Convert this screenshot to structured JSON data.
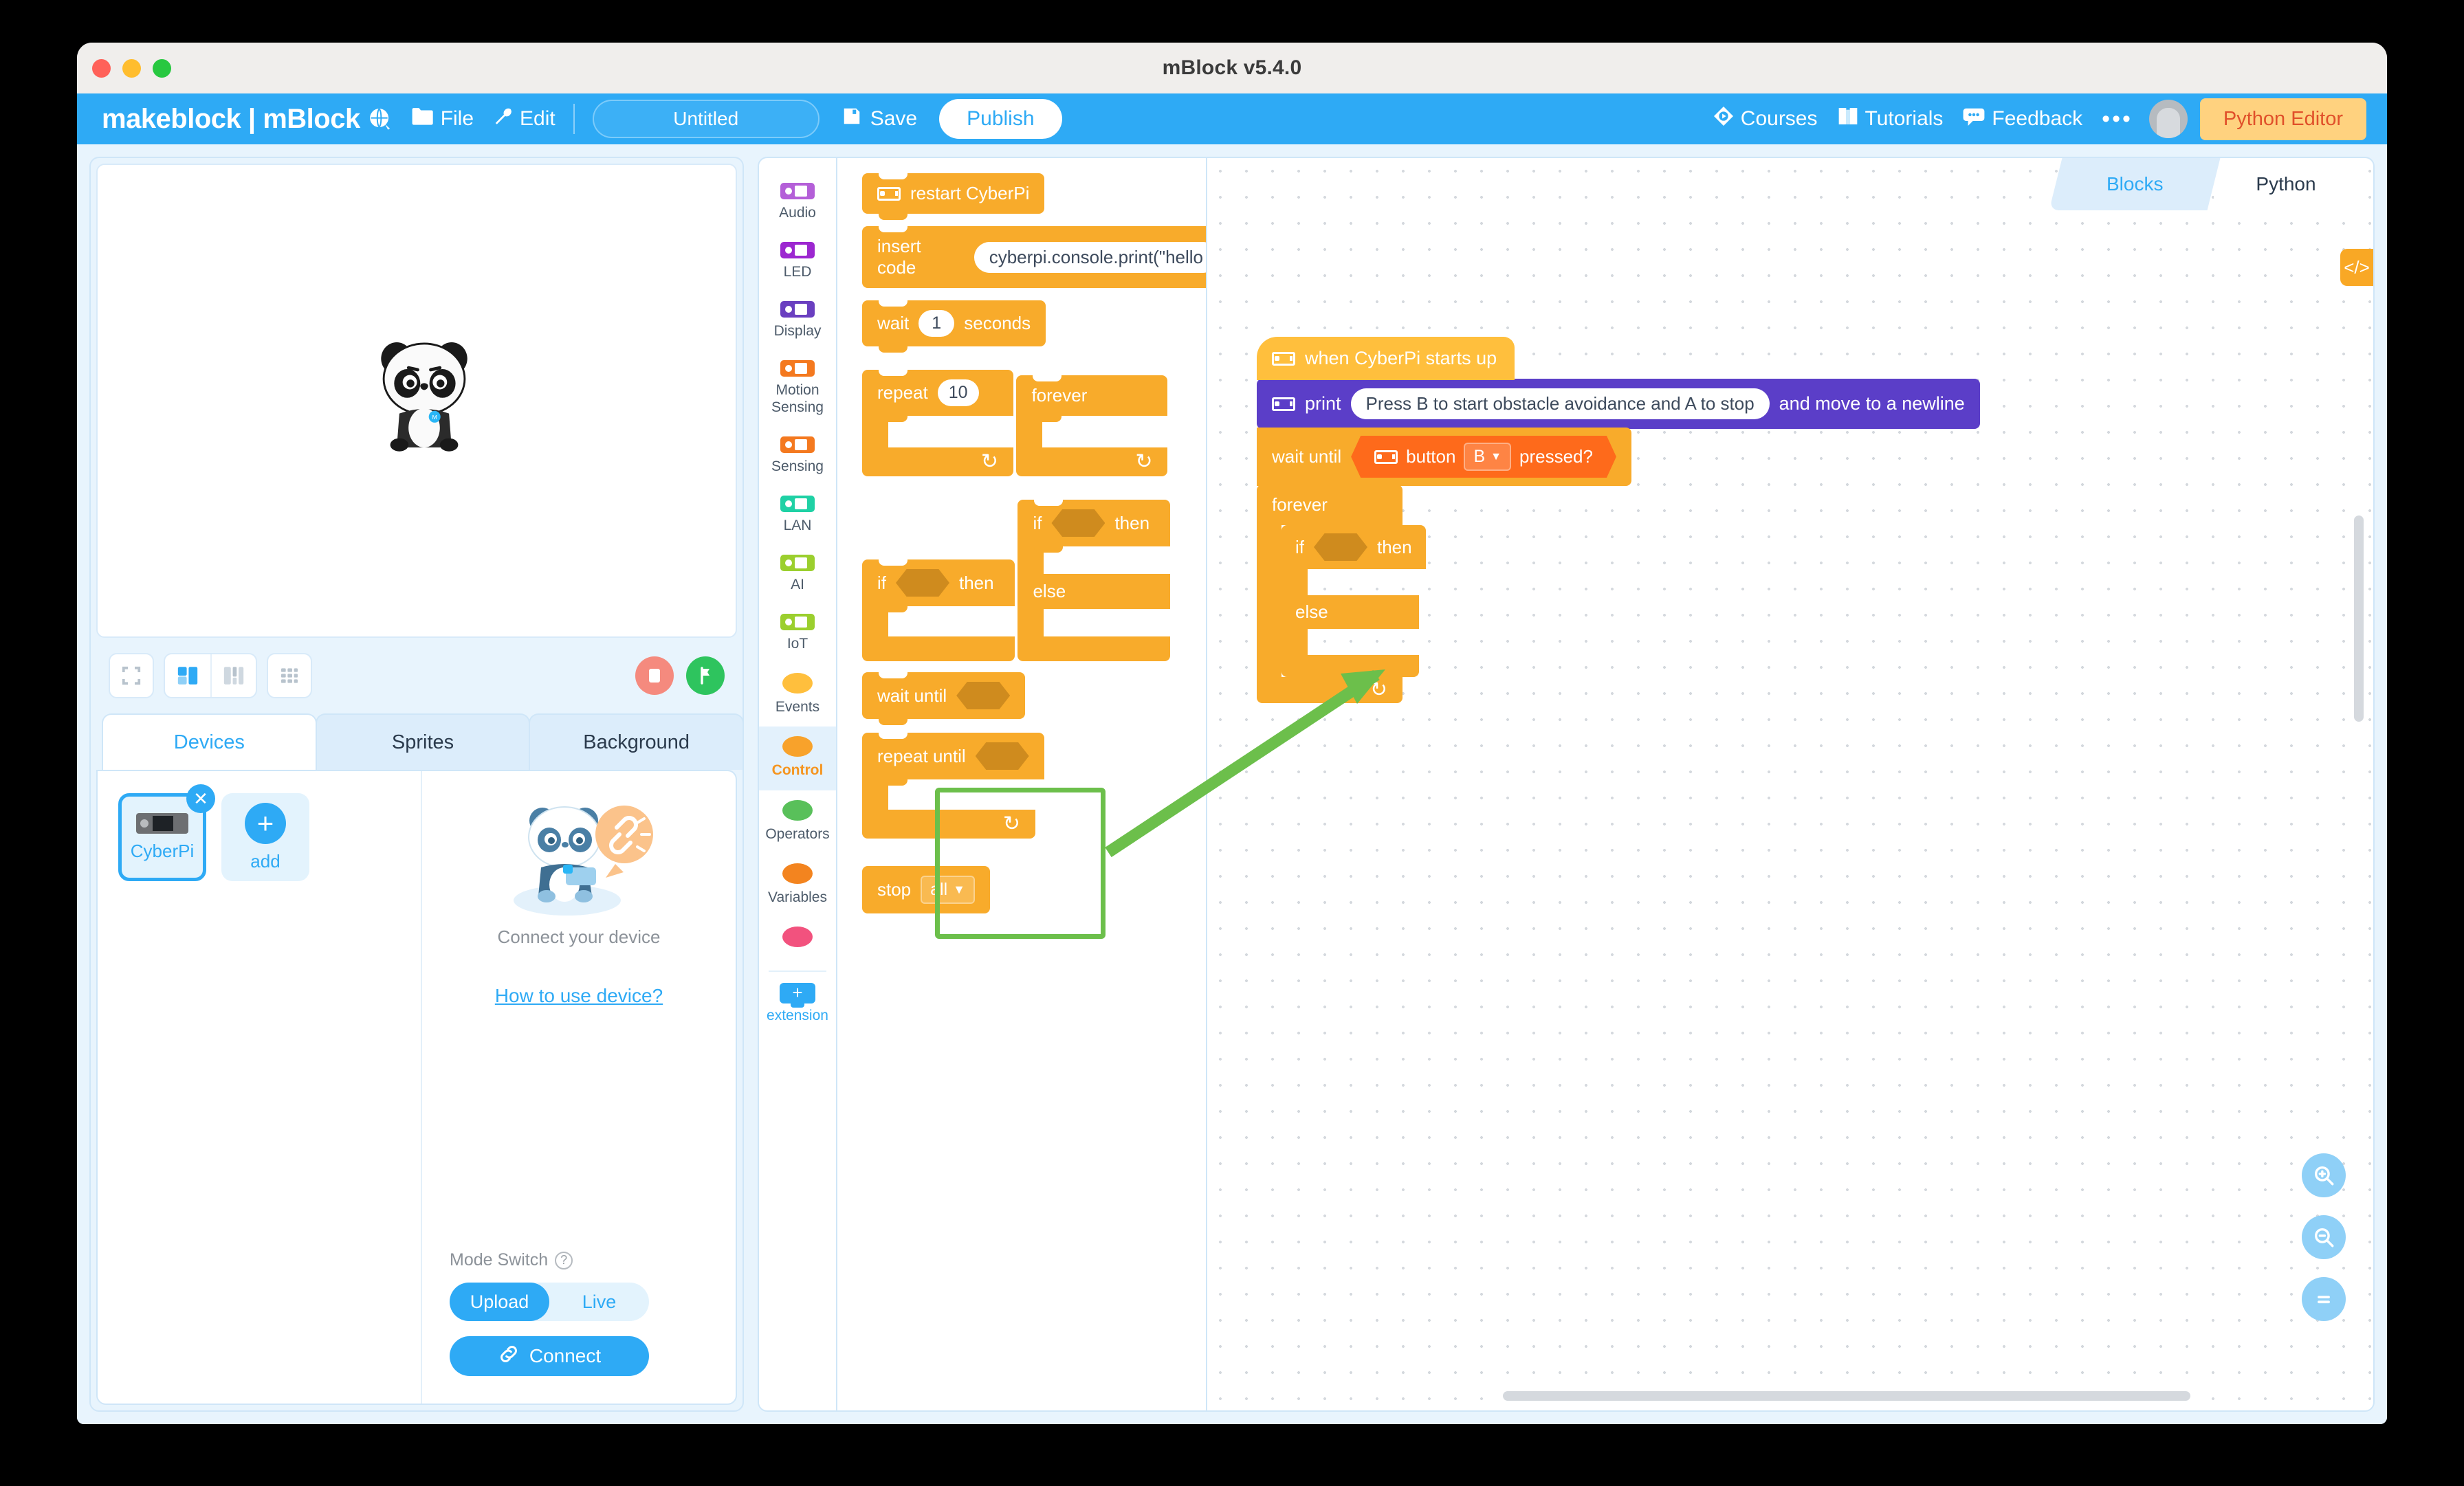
{
  "window": {
    "title": "mBlock v5.4.0",
    "traffic_lights": [
      "close",
      "minimize",
      "maximize"
    ]
  },
  "header": {
    "brand": "makeblock | mBlock",
    "globe_icon": "globe-language-icon",
    "file_menu": "File",
    "file_icon": "folder-icon",
    "edit_menu": "Edit",
    "edit_icon": "wrench-icon",
    "project_name": "Untitled",
    "project_placeholder": "Untitled",
    "save_label": "Save",
    "save_icon": "floppy-disk-icon",
    "publish_label": "Publish",
    "courses_label": "Courses",
    "courses_icon": "diamond-play-icon",
    "tutorials_label": "Tutorials",
    "tutorials_icon": "book-icon",
    "feedback_label": "Feedback",
    "feedback_icon": "speech-bubble-icon",
    "more_label": "•••",
    "avatar_label": "avatar",
    "python_editor_label": "Python Editor",
    "accent_blue": "#2eaaf5",
    "python_btn_bg": "#ffd27f",
    "python_btn_fg": "#e0502a"
  },
  "stage": {
    "sprite_name": "panda-sprite",
    "toolbar": {
      "fullscreen_icon": "fullscreen-icon",
      "layout_small_icon": "layout-small-stage-icon",
      "layout_large_icon": "layout-large-stage-icon",
      "grid_icon": "grid-layout-icon",
      "stop_icon": "stop-icon",
      "start_icon": "green-flag-icon"
    }
  },
  "panel_tabs": [
    {
      "label": "Devices",
      "active": true
    },
    {
      "label": "Sprites",
      "active": false
    },
    {
      "label": "Background",
      "active": false
    }
  ],
  "devices": {
    "items": [
      {
        "label": "CyberPi",
        "selected": true,
        "icon": "cyberpi-board-icon",
        "close_icon": "close-icon"
      },
      {
        "label": "add",
        "selected": false,
        "icon": "plus-icon"
      }
    ],
    "connect_illustration": "panda-connect-illustration",
    "connect_title": "Connect your device",
    "how_to_link": "How to use device?",
    "mode_switch_label": "Mode Switch",
    "mode_help_icon": "question-mark-icon",
    "modes": [
      {
        "label": "Upload",
        "active": true
      },
      {
        "label": "Live",
        "active": false
      }
    ],
    "connect_button": "Connect",
    "connect_icon": "link-chain-icon"
  },
  "categories": [
    {
      "label": "Audio",
      "color": "#b45fd8",
      "kind": "chip",
      "active": false
    },
    {
      "label": "LED",
      "color": "#9c27d0",
      "kind": "chip",
      "active": false
    },
    {
      "label": "Display",
      "color": "#6a3fc0",
      "kind": "chip",
      "active": false
    },
    {
      "label": "Motion Sensing",
      "color": "#f4791f",
      "kind": "chip",
      "active": false
    },
    {
      "label": "Sensing",
      "color": "#f4791f",
      "kind": "chip",
      "active": false
    },
    {
      "label": "LAN",
      "color": "#1fd1a5",
      "kind": "chip",
      "active": false
    },
    {
      "label": "AI",
      "color": "#9bcf2e",
      "kind": "chip",
      "active": false
    },
    {
      "label": "IoT",
      "color": "#9bcf2e",
      "kind": "chip",
      "active": false
    },
    {
      "label": "Events",
      "color": "#ffbf3d",
      "kind": "dot",
      "active": false
    },
    {
      "label": "Control",
      "color": "#f8a22b",
      "kind": "dot",
      "active": true
    },
    {
      "label": "Operators",
      "color": "#59c05a",
      "kind": "dot",
      "active": false
    },
    {
      "label": "Variables",
      "color": "#f3841f",
      "kind": "dot",
      "active": false
    },
    {
      "label": "",
      "color": "#f2527e",
      "kind": "dot",
      "active": false
    }
  ],
  "extension": {
    "label": "extension",
    "icon": "plus-extension-icon"
  },
  "palette": {
    "blocks": [
      {
        "id": "restart",
        "text": "restart CyberPi",
        "icon": "cyberpi-chip-icon"
      },
      {
        "id": "insert_code",
        "text": "insert code",
        "value": "cyberpi.console.print(\"hello"
      },
      {
        "id": "wait",
        "text_before": "wait",
        "value": "1",
        "text_after": "seconds"
      },
      {
        "id": "repeat",
        "text": "repeat",
        "value": "10"
      },
      {
        "id": "forever",
        "text": "forever"
      },
      {
        "id": "if_then",
        "text_before": "if",
        "text_after": "then"
      },
      {
        "id": "if_then_else",
        "text_before": "if",
        "text_after": "then",
        "else_label": "else",
        "highlighted": true
      },
      {
        "id": "wait_until",
        "text": "wait until"
      },
      {
        "id": "repeat_until",
        "text": "repeat until"
      },
      {
        "id": "stop",
        "text": "stop",
        "dropdown": "all"
      }
    ]
  },
  "workspace": {
    "tabs": [
      {
        "label": "Blocks",
        "active": true
      },
      {
        "label": "Python",
        "active": false
      }
    ],
    "code_toggle_icon": "code-brackets-icon",
    "zoom_controls": [
      {
        "icon": "zoom-in-icon",
        "label": "+"
      },
      {
        "icon": "zoom-out-icon",
        "label": "−"
      },
      {
        "icon": "zoom-reset-icon",
        "label": "="
      }
    ],
    "script": {
      "hat": {
        "text": "when CyberPi starts up",
        "icon": "cyberpi-chip-icon",
        "color": "#ffbf3d"
      },
      "print": {
        "label": "print",
        "value": "Press B to start obstacle avoidance and A to stop",
        "suffix": "and move to a newline",
        "icon": "cyberpi-chip-icon",
        "color": "#5b3ec8"
      },
      "wait_until": {
        "label": "wait until",
        "condition_icon": "cyberpi-chip-icon",
        "condition_label": "button",
        "condition_dropdown": "B",
        "condition_suffix": "pressed?",
        "condition_color": "#fe6a1b"
      },
      "forever": {
        "label": "forever"
      },
      "if_else": {
        "if_label": "if",
        "then_label": "then",
        "else_label": "else"
      }
    }
  },
  "annotation": {
    "arrow_color": "#6cbf4b",
    "highlight_color": "#6cbf4b",
    "description": "green arrow from highlighted if-then-else palette block to workspace if-else block"
  }
}
